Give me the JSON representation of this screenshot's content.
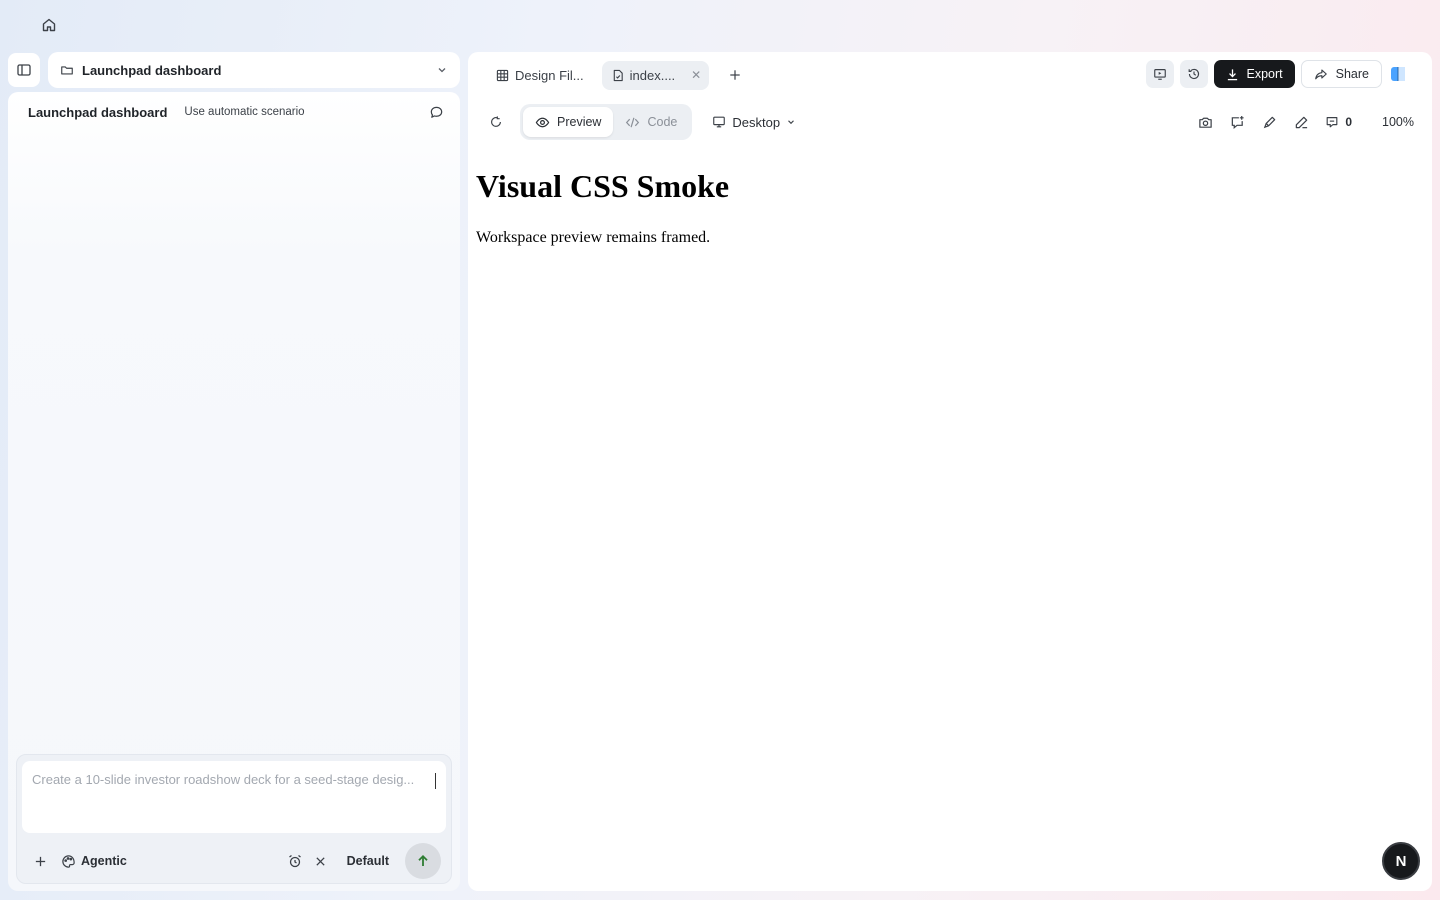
{
  "project": {
    "name": "Launchpad dashboard"
  },
  "chat": {
    "title": "Launchpad dashboard",
    "scenario_label": "Use automatic scenario"
  },
  "composer": {
    "placeholder": "Create a 10-slide investor roadshow deck for a seed-stage desig...",
    "mode_label": "Agentic",
    "model_label": "Default"
  },
  "tabs": [
    {
      "label": "Design Fil...",
      "icon": "grid-icon"
    },
    {
      "label": "index....",
      "icon": "file-icon",
      "active": true
    }
  ],
  "toolbar": {
    "export_label": "Export",
    "share_label": "Share"
  },
  "viewbar": {
    "preview_label": "Preview",
    "code_label": "Code",
    "device_label": "Desktop",
    "comment_count": "0",
    "zoom": "100%"
  },
  "preview": {
    "heading": "Visual CSS Smoke",
    "body": "Workspace preview remains framed."
  },
  "user": {
    "avatar_initial": "N"
  },
  "colors": {
    "accent_dark": "#17191c",
    "send_arrow": "#2e7d32",
    "panel_bg": "#ffffff"
  }
}
